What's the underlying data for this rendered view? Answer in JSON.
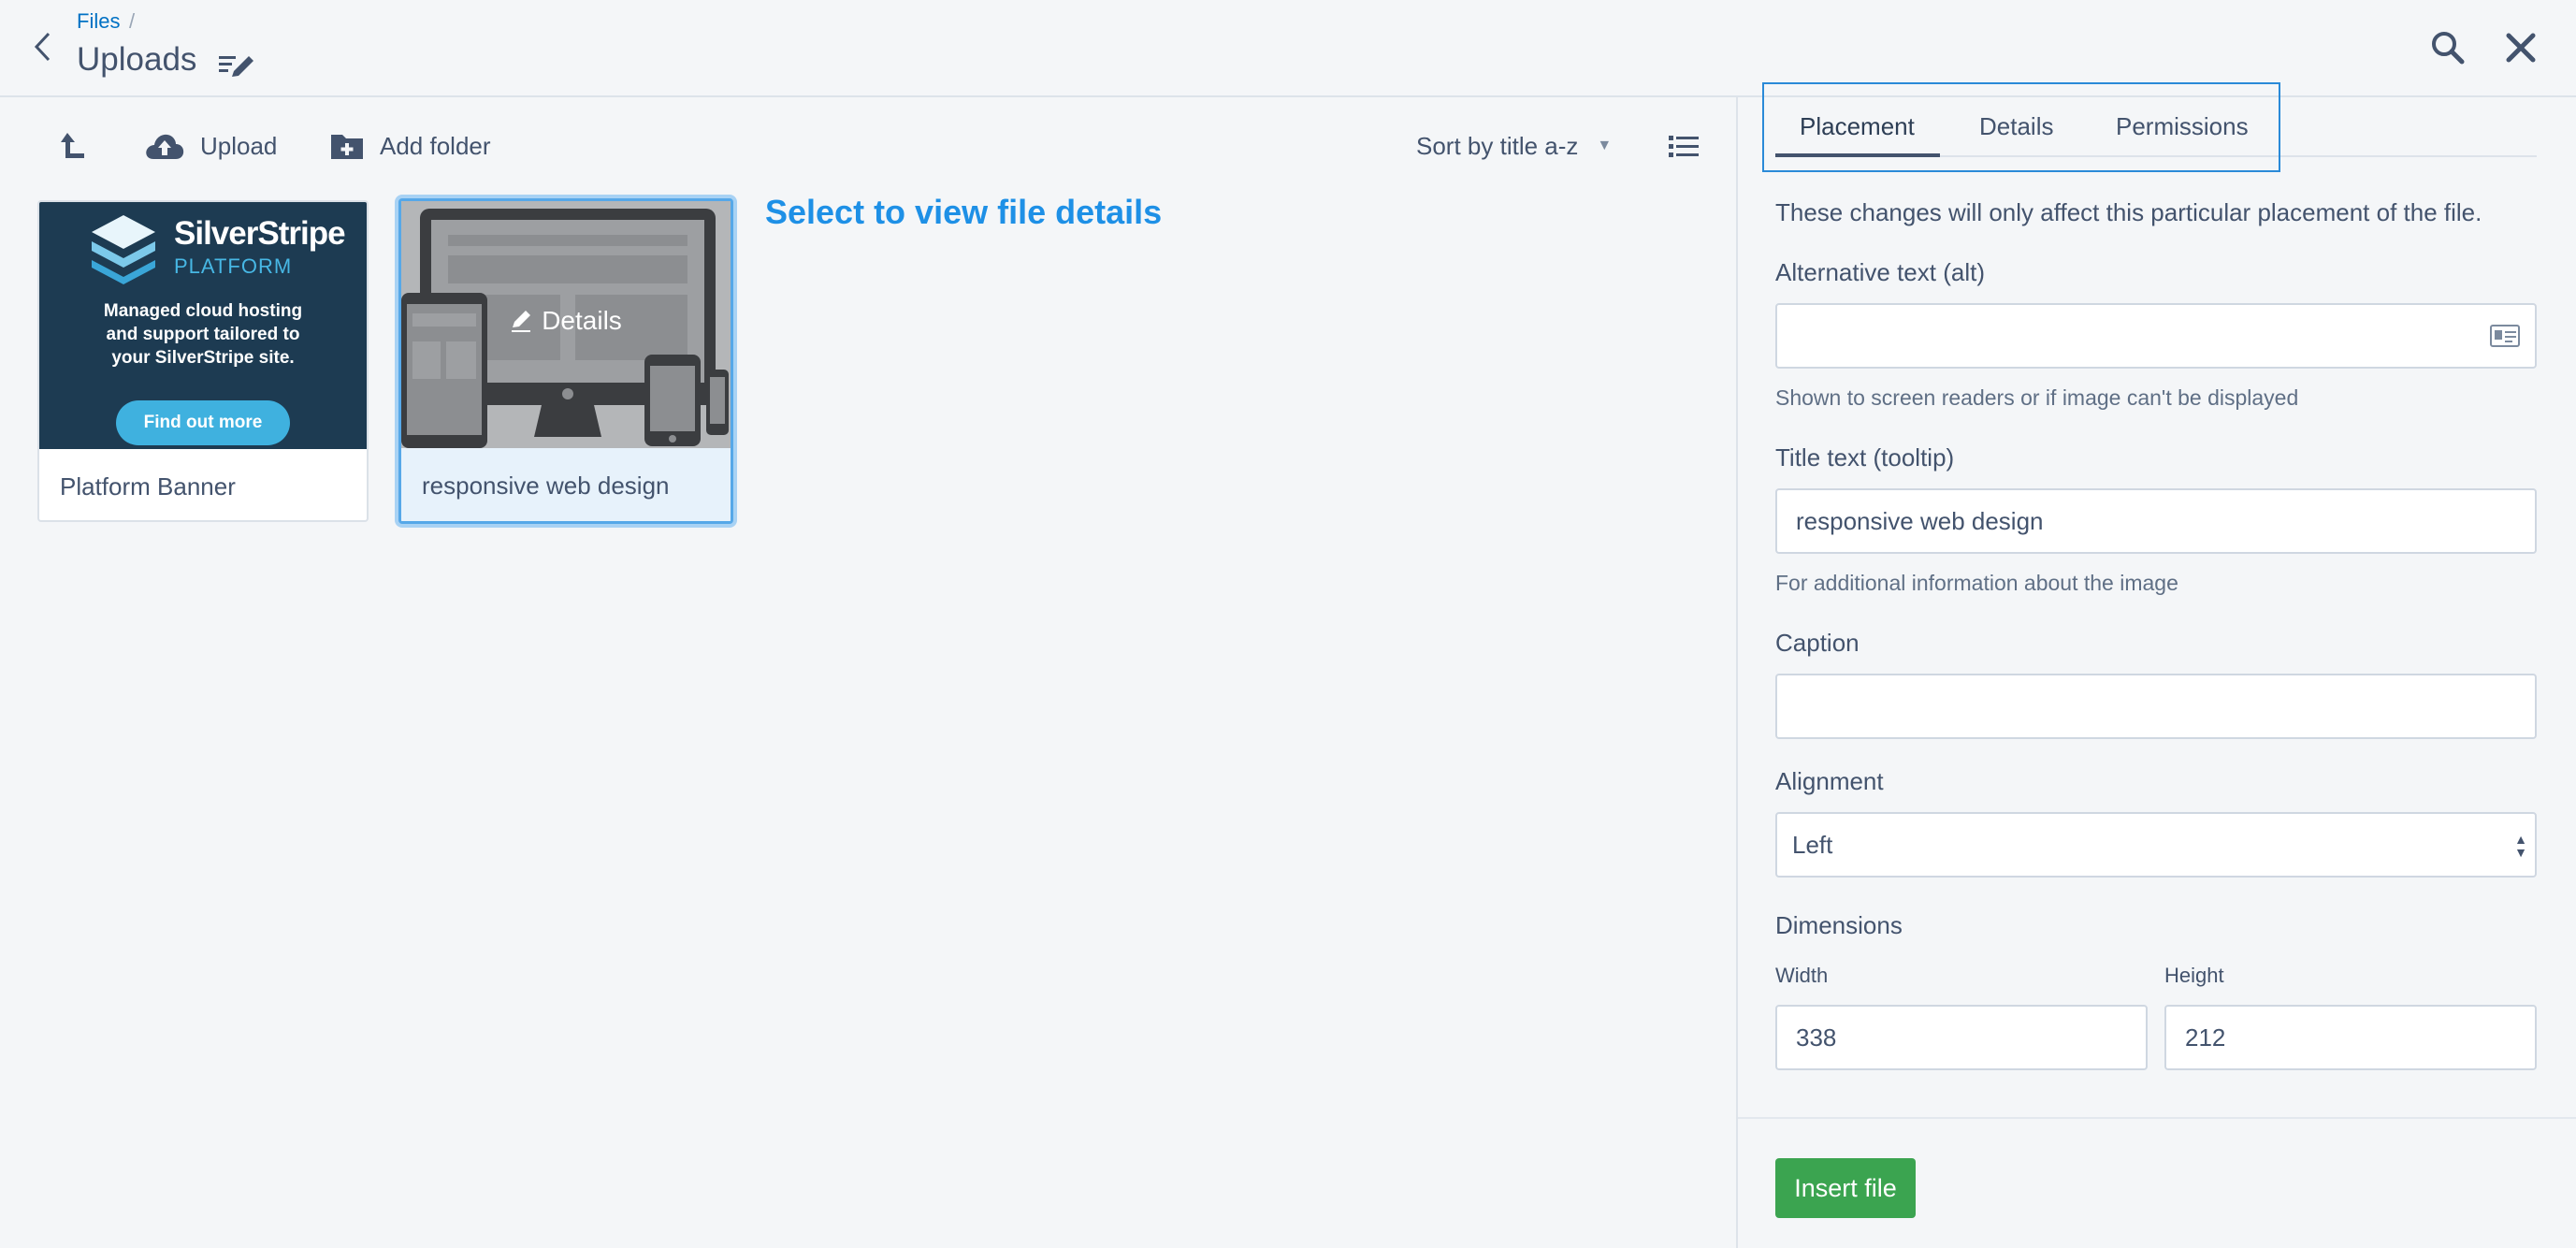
{
  "header": {
    "breadcrumb_link": "Files",
    "breadcrumb_separator": "/",
    "title": "Uploads"
  },
  "toolbar": {
    "upload_label": "Upload",
    "add_folder_label": "Add folder",
    "sort_label": "Sort by title a-z"
  },
  "gallery": {
    "items": [
      {
        "title": "Platform Banner",
        "banner_brand": "SilverStripe",
        "banner_platform": "PLATFORM",
        "banner_lines": [
          "Managed cloud hosting",
          "and support tailored to",
          "your SilverStripe site."
        ],
        "banner_cta": "Find out more"
      },
      {
        "title": "responsive web design",
        "overlay_label": "Details",
        "selected": true
      }
    ],
    "hint": "Select to view file details"
  },
  "panel": {
    "tabs": [
      {
        "label": "Placement",
        "active": true
      },
      {
        "label": "Details",
        "active": false
      },
      {
        "label": "Permissions",
        "active": false
      }
    ],
    "note": "These changes will only affect this particular placement of the file.",
    "alt_label": "Alternative text (alt)",
    "alt_value": "",
    "alt_help": "Shown to screen readers or if image can't be displayed",
    "title_label": "Title text (tooltip)",
    "title_value": "responsive web design",
    "title_help": "For additional information about the image",
    "caption_label": "Caption",
    "caption_value": "",
    "alignment_label": "Alignment",
    "alignment_value": "Left",
    "dimensions_label": "Dimensions",
    "width_label": "Width",
    "width_value": "338",
    "height_label": "Height",
    "height_value": "212",
    "insert_label": "Insert file"
  },
  "colors": {
    "accent": "#0071c4",
    "hint": "#1e90e6",
    "primary_button": "#3ba450",
    "banner_background": "#1d3b52",
    "selection_border": "#56a8e8"
  }
}
